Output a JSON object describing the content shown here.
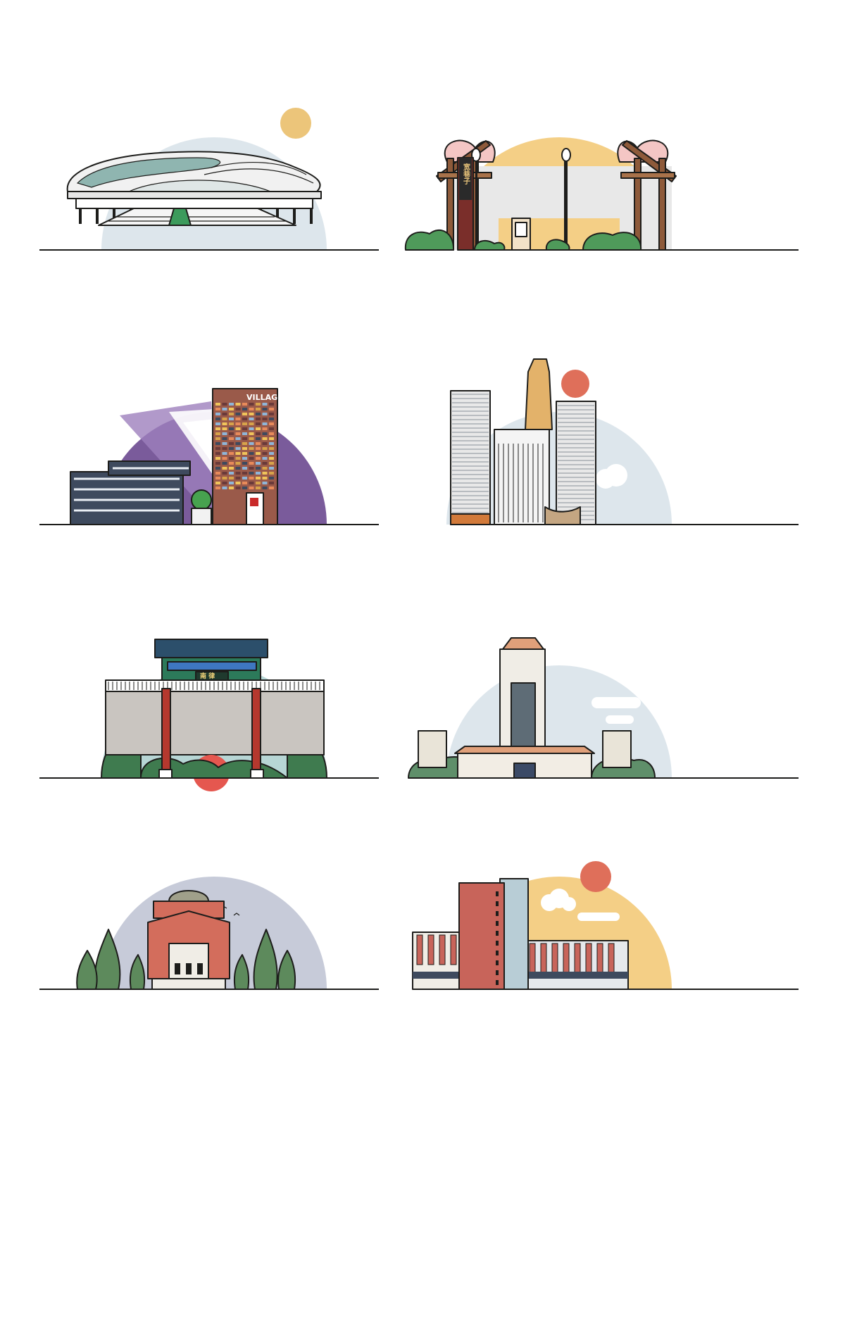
{
  "illustrations": [
    {
      "landmark": "stadium",
      "palette": {
        "backdrop": "#dde6ec",
        "sun": "#ecc57a"
      }
    },
    {
      "landmark": "wooden-gate",
      "sign": "宽巷子",
      "palette": {
        "backdrop": "#f4cf86",
        "blossom": "#f4c6c4"
      }
    },
    {
      "landmark": "village-complex",
      "sign": "VILLAGE",
      "palette": {
        "backdrop": "#7a5b9b",
        "building": "#9a5a4a"
      }
    },
    {
      "landmark": "skyscraper-cluster",
      "palette": {
        "backdrop": "#dde6ec",
        "sun": "#df6f5a",
        "tower": "#e3b26a"
      }
    },
    {
      "landmark": "arch-gateway",
      "sign": "南 律",
      "palette": {
        "backdrop": "#b7d6d5",
        "trees": "#3f7b4f",
        "sun": "#e5574f"
      }
    },
    {
      "landmark": "university-tower",
      "palette": {
        "backdrop": "#dde6ec",
        "roof": "#e0a07a"
      }
    },
    {
      "landmark": "domed-auditorium",
      "palette": {
        "backdrop": "#c7cbd9",
        "building": "#d36d5c",
        "trees": "#5d8a5c"
      }
    },
    {
      "landmark": "brick-campus",
      "palette": {
        "backdrop": "#f4cf86",
        "sun": "#df6f5a",
        "building": "#c8645a"
      }
    }
  ]
}
